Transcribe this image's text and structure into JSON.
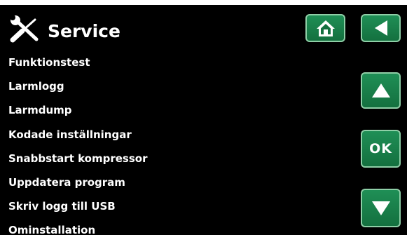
{
  "header": {
    "title": "Service",
    "icon": "wrench-screwdriver-icon"
  },
  "nav": {
    "home_icon": "home-icon",
    "back_icon": "back-arrow-icon",
    "up_icon": "arrow-up-icon",
    "down_icon": "arrow-down-icon",
    "ok_label": "OK"
  },
  "menu": {
    "items": [
      {
        "label": "Funktionstest"
      },
      {
        "label": "Larmlogg"
      },
      {
        "label": "Larmdump"
      },
      {
        "label": "Kodade inställningar"
      },
      {
        "label": "Snabbstart kompressor"
      },
      {
        "label": "Uppdatera program"
      },
      {
        "label": "Skriv logg till USB"
      },
      {
        "label": "Ominstallation"
      }
    ]
  },
  "colors": {
    "background": "#000000",
    "text": "#ffffff",
    "button_fill": "#1a8a4f",
    "button_border": "#8fcfa7"
  }
}
